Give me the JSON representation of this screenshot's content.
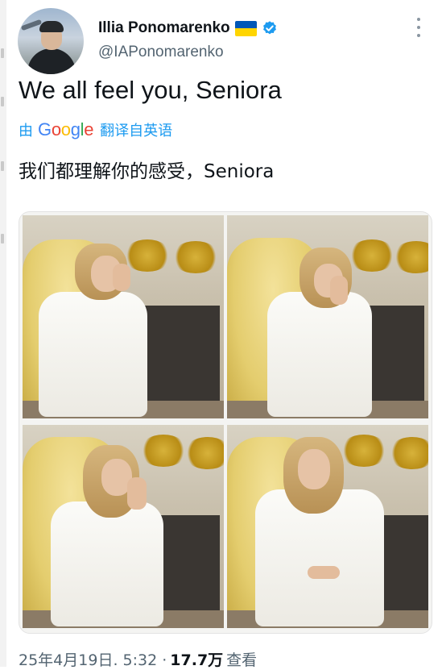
{
  "author": {
    "display_name": "Illia Ponomarenko",
    "handle": "@IAPonomarenko"
  },
  "icons": {
    "flag": "ukraine-flag-icon",
    "verified": "verified-badge-icon",
    "more": "more-options-icon"
  },
  "colors": {
    "link": "#1d9bf0",
    "verified": "#1d9bf0",
    "secondary_text": "#536471"
  },
  "tweet": {
    "text": "We all feel you, Seniora",
    "translation_prefix": "由",
    "translation_brand": "Google",
    "translation_suffix": "翻译自英语",
    "translated_text": "我们都理解你的感受，Seniora"
  },
  "meta": {
    "timestamp": "25年4月19日. 5:32 ·",
    "views_count": "17.7万",
    "views_label": "查看"
  }
}
